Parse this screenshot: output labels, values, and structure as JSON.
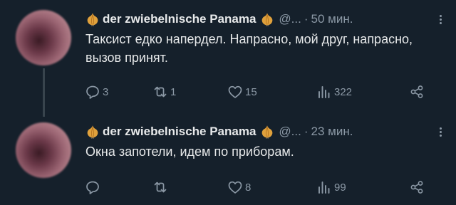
{
  "tweets": [
    {
      "author_name": "der zwiebelnische Panama",
      "handle": "@...",
      "separator": "·",
      "time": "50 мин.",
      "text": "Таксист едко напердел. Напрасно, мой друг, напрасно, вызов принят.",
      "stats": {
        "replies": "3",
        "retweets": "1",
        "likes": "15",
        "views": "322"
      }
    },
    {
      "author_name": "der zwiebelnische Panama",
      "handle": "@...",
      "separator": "·",
      "time": "23 мин.",
      "text": "Окна запотели, идем по приборам.",
      "stats": {
        "replies": "",
        "retweets": "",
        "likes": "8",
        "views": "99"
      }
    }
  ],
  "icons": {
    "name_emoji": "onion-icon",
    "reply": "reply-icon",
    "retweet": "retweet-icon",
    "like": "heart-icon",
    "views": "views-chart-icon",
    "share": "share-icon",
    "more": "more-options-icon"
  },
  "colors": {
    "background": "#15202b",
    "text": "#e7e9ea",
    "secondary": "#8b98a5",
    "thread_line": "#38444d"
  }
}
